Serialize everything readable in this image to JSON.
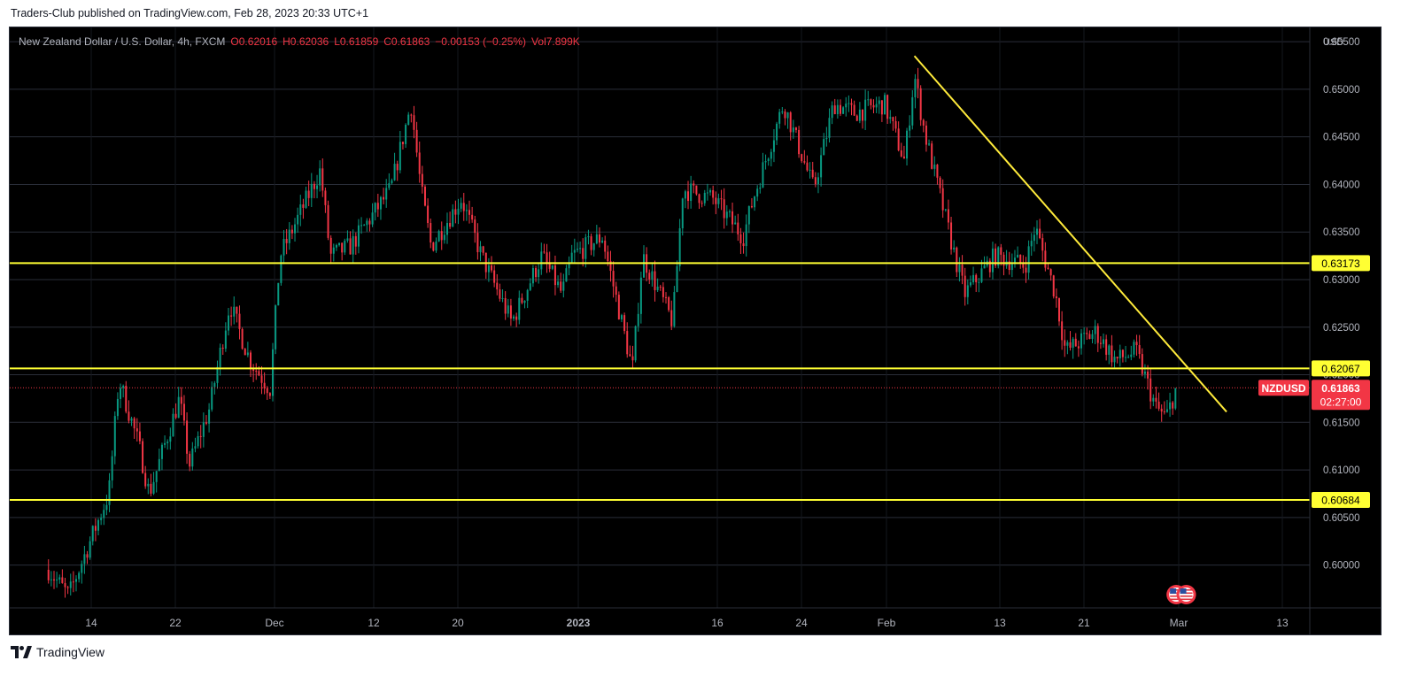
{
  "header": {
    "published": "Traders-Club published on TradingView.com, Feb 28, 2023 20:33 UTC+1"
  },
  "legend": {
    "symbol": "New Zealand Dollar / U.S. Dollar, 4h, FXCM",
    "open": "O0.62016",
    "high": "H0.62036",
    "low": "L0.61859",
    "close": "C0.61863",
    "change": "−0.00153 (−0.25%)",
    "volume": "Vol7.899K"
  },
  "footer": {
    "brand": "TradingView"
  },
  "colors": {
    "background": "#000000",
    "grid": "#2a2e39",
    "bull": "#089981",
    "bear": "#f23645",
    "level_line": "#ffff33",
    "trend_line": "#ffeb3b",
    "price_badge": "#f23645",
    "axis_text": "#b2b5be"
  },
  "icons": {
    "event_markers": "us-flag-icon"
  },
  "chart_data": {
    "type": "candlestick",
    "symbol": "NZDUSD",
    "timeframe": "4h",
    "currency": "USD",
    "ylim": [
      0.5955,
      0.6565
    ],
    "y_ticks": [
      "0.65500",
      "0.65000",
      "0.64500",
      "0.64000",
      "0.63500",
      "0.63000",
      "0.62500",
      "0.62000",
      "0.61500",
      "0.61000",
      "0.60500",
      "0.60000"
    ],
    "x_ticks": [
      "14",
      "22",
      "Dec",
      "12",
      "20",
      "2023",
      "16",
      "24",
      "Feb",
      "13",
      "21",
      "Mar",
      "13"
    ],
    "grid": true,
    "current_price": {
      "label": "NZDUSD",
      "value": "0.61863",
      "countdown": "02:27:00"
    },
    "horizontal_levels": [
      {
        "value": 0.63173,
        "label": "0.63173"
      },
      {
        "value": 0.62067,
        "label": "0.62067"
      },
      {
        "value": 0.60684,
        "label": "0.60684"
      }
    ],
    "trend_line": {
      "start": {
        "date": "2023-02-02",
        "price": 0.6535
      },
      "end": {
        "date": "2023-03-05",
        "price": 0.6161
      }
    },
    "event_markers": [
      "2023-02-28",
      "2023-03-01"
    ],
    "price_path_anchors": [
      {
        "date": "2022-11-08",
        "price": 0.5995
      },
      {
        "date": "2022-11-10",
        "price": 0.5968
      },
      {
        "date": "2022-11-14",
        "price": 0.6075
      },
      {
        "date": "2022-11-15",
        "price": 0.6195
      },
      {
        "date": "2022-11-17",
        "price": 0.6125
      },
      {
        "date": "2022-11-18",
        "price": 0.6075
      },
      {
        "date": "2022-11-21",
        "price": 0.6175
      },
      {
        "date": "2022-11-22",
        "price": 0.6105
      },
      {
        "date": "2022-11-24",
        "price": 0.6165
      },
      {
        "date": "2022-11-26",
        "price": 0.6275
      },
      {
        "date": "2022-11-28",
        "price": 0.6215
      },
      {
        "date": "2022-11-30",
        "price": 0.6185
      },
      {
        "date": "2022-12-01",
        "price": 0.6325
      },
      {
        "date": "2022-12-05",
        "price": 0.6415
      },
      {
        "date": "2022-12-06",
        "price": 0.6325
      },
      {
        "date": "2022-12-08",
        "price": 0.6335
      },
      {
        "date": "2022-12-12",
        "price": 0.6395
      },
      {
        "date": "2022-12-14",
        "price": 0.6485
      },
      {
        "date": "2022-12-15",
        "price": 0.6395
      },
      {
        "date": "2022-12-16",
        "price": 0.6335
      },
      {
        "date": "2022-12-19",
        "price": 0.6385
      },
      {
        "date": "2022-12-21",
        "price": 0.6325
      },
      {
        "date": "2022-12-24",
        "price": 0.6255
      },
      {
        "date": "2022-12-27",
        "price": 0.6325
      },
      {
        "date": "2022-12-29",
        "price": 0.6285
      },
      {
        "date": "2022-12-30",
        "price": 0.6325
      },
      {
        "date": "2023-01-02",
        "price": 0.6345
      },
      {
        "date": "2023-01-05",
        "price": 0.6205
      },
      {
        "date": "2023-01-06",
        "price": 0.6325
      },
      {
        "date": "2023-01-09",
        "price": 0.6255
      },
      {
        "date": "2023-01-10",
        "price": 0.6395
      },
      {
        "date": "2023-01-13",
        "price": 0.6385
      },
      {
        "date": "2023-01-16",
        "price": 0.6345
      },
      {
        "date": "2023-01-17",
        "price": 0.6385
      },
      {
        "date": "2023-01-20",
        "price": 0.6485
      },
      {
        "date": "2023-01-23",
        "price": 0.6395
      },
      {
        "date": "2023-01-25",
        "price": 0.6485
      },
      {
        "date": "2023-01-27",
        "price": 0.6475
      },
      {
        "date": "2023-01-30",
        "price": 0.6485
      },
      {
        "date": "2023-02-01",
        "price": 0.6425
      },
      {
        "date": "2023-02-02",
        "price": 0.6515
      },
      {
        "date": "2023-02-03",
        "price": 0.6455
      },
      {
        "date": "2023-02-06",
        "price": 0.6325
      },
      {
        "date": "2023-02-07",
        "price": 0.6285
      },
      {
        "date": "2023-02-10",
        "price": 0.6325
      },
      {
        "date": "2023-02-13",
        "price": 0.6315
      },
      {
        "date": "2023-02-14",
        "price": 0.6355
      },
      {
        "date": "2023-02-16",
        "price": 0.6285
      },
      {
        "date": "2023-02-17",
        "price": 0.6225
      },
      {
        "date": "2023-02-20",
        "price": 0.6245
      },
      {
        "date": "2023-02-22",
        "price": 0.6215
      },
      {
        "date": "2023-02-24",
        "price": 0.6225
      },
      {
        "date": "2023-02-26",
        "price": 0.6165
      },
      {
        "date": "2023-02-27",
        "price": 0.6155
      },
      {
        "date": "2023-02-28",
        "price": 0.6186
      }
    ]
  }
}
